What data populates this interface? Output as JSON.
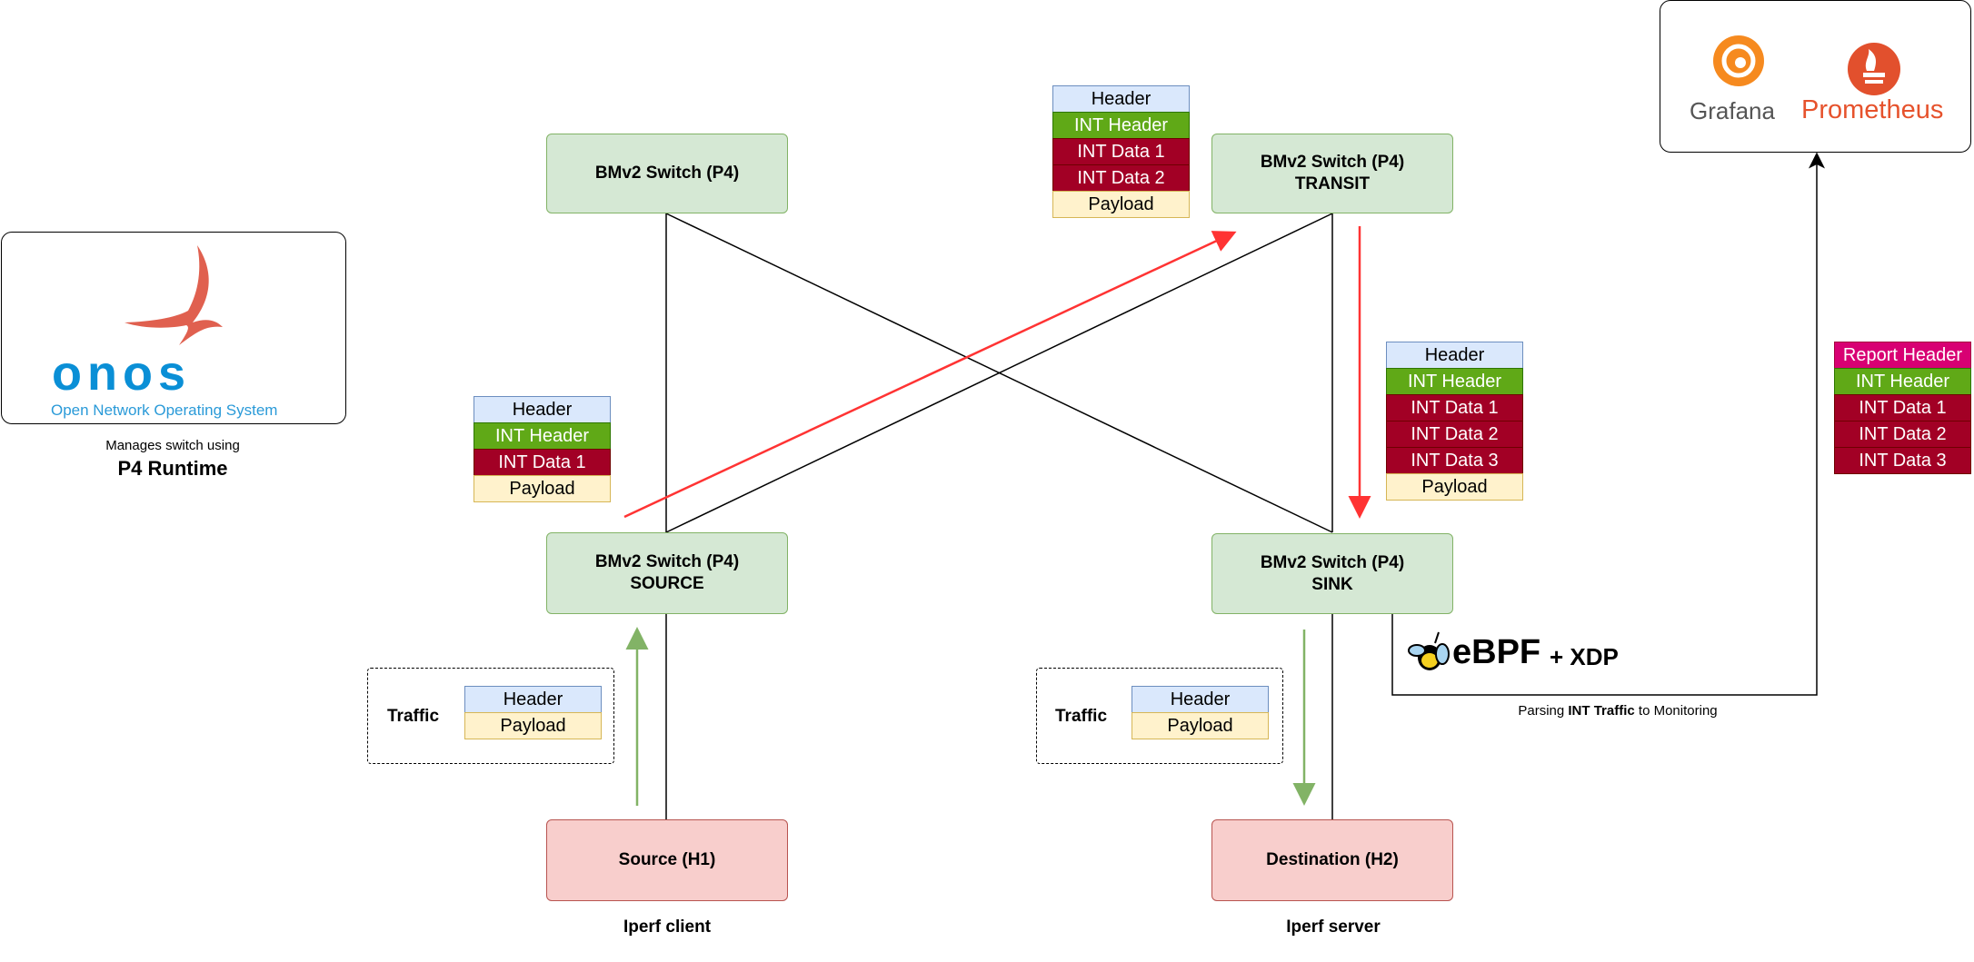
{
  "onos": {
    "logo_text": "onos",
    "tagline": "Open Network Operating System",
    "caption_line1": "Manages switch using",
    "caption_line2": "P4 Runtime"
  },
  "monitoring": {
    "grafana": "Grafana",
    "prometheus": "Prometheus"
  },
  "switches": {
    "top_left": {
      "title": "BMv2 Switch (P4)"
    },
    "transit": {
      "title": "BMv2 Switch (P4)",
      "role": "TRANSIT"
    },
    "source": {
      "title": "BMv2 Switch (P4)",
      "role": "SOURCE"
    },
    "sink": {
      "title": "BMv2 Switch (P4)",
      "role": "SINK"
    }
  },
  "hosts": {
    "source": {
      "title": "Source (H1)",
      "caption": "Iperf client"
    },
    "destination": {
      "title": "Destination (H2)",
      "caption": "Iperf server"
    }
  },
  "packets": {
    "source_out": [
      "Header",
      "INT Header",
      "INT Data 1",
      "Payload"
    ],
    "transit_out": [
      "Header",
      "INT Header",
      "INT Data 1",
      "INT Data 2",
      "Payload"
    ],
    "sink_in": [
      "Header",
      "INT Header",
      "INT Data 1",
      "INT Data 2",
      "INT Data 3",
      "Payload"
    ],
    "report": [
      "Report Header",
      "INT Header",
      "INT Data 1",
      "INT Data 2",
      "INT Data 3"
    ]
  },
  "traffic": {
    "label": "Traffic",
    "rows": [
      "Header",
      "Payload"
    ]
  },
  "ebpf": {
    "logo_text": "eBPF",
    "suffix": "+ XDP"
  },
  "monitoring_link": {
    "prefix": "Parsing ",
    "bold": "INT Traffic",
    "suffix": " to Monitoring"
  },
  "colors": {
    "int_path": "#ff3333",
    "traffic_path": "#82b366",
    "switch_fill": "#d5e8d4",
    "host_fill": "#f8cecc"
  }
}
